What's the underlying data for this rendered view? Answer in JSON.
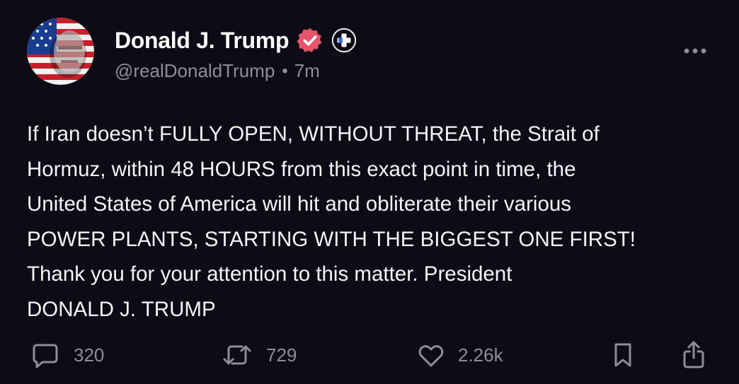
{
  "author": {
    "display_name": "Donald J. Trump",
    "handle": "@realDonaldTrump",
    "separator": "•",
    "time_ago": "7m",
    "verified_color": "#e8546a",
    "plus_badge_symbol": "+"
  },
  "post": {
    "text": "If Iran doesn’t FULLY OPEN, WITHOUT THREAT, the Strait of\nHormuz, within 48 HOURS from this exact point in time, the\nUnited States of America will hit and obliterate their various\nPOWER PLANTS, STARTING WITH THE BIGGEST ONE FIRST!\nThank you for your attention to this matter. President\nDONALD J. TRUMP"
  },
  "actions": {
    "replies": "320",
    "reposts": "729",
    "likes": "2.26k",
    "icons": [
      "comment-icon",
      "repost-icon",
      "heart-icon",
      "bookmark-icon",
      "share-icon"
    ]
  },
  "colors": {
    "background": "#0c0b16",
    "text": "#f5f5f7",
    "muted": "#8e8e96"
  }
}
